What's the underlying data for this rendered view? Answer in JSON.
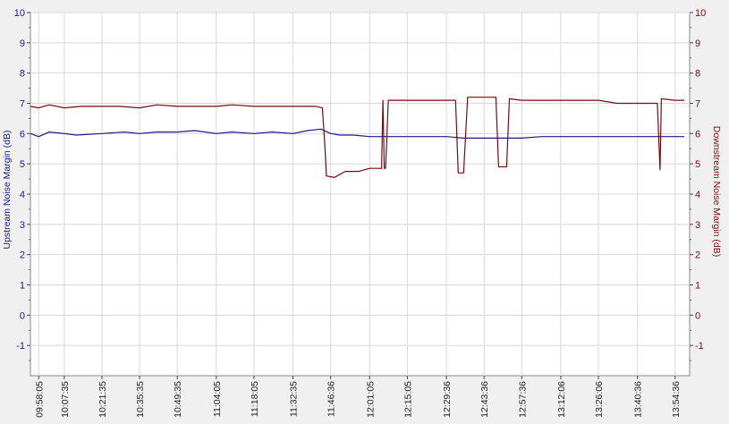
{
  "chart_data": {
    "type": "line",
    "title": "",
    "xlabel": "",
    "y_left_label": "Upstream Noise Margin (dB)",
    "y_right_label": "Downstream Noise Margin (dB)",
    "ylim": [
      -2,
      10
    ],
    "y_ticks": [
      -1,
      0,
      1,
      2,
      3,
      4,
      5,
      6,
      7,
      8,
      9,
      10
    ],
    "grid": true,
    "legend": "none",
    "colors": {
      "upstream": "#1a1a8c",
      "downstream": "#7a0a0a",
      "left_axis_text": "#1a1a8c",
      "right_axis_text": "#7a0a0a",
      "grid": "#d8d8d8"
    },
    "x_ticks": [
      "09:58:05",
      "10:07:35",
      "10:21:35",
      "10:35:35",
      "10:49:35",
      "11:04:05",
      "11:18:05",
      "11:32:35",
      "11:46:36",
      "12:01:05",
      "12:15:05",
      "12:29:36",
      "12:43:36",
      "12:57:36",
      "13:12:06",
      "13:26:06",
      "13:40:36",
      "13:54:36"
    ],
    "x_tick_times": [
      "09:58:05",
      "10:07:35",
      "10:21:35",
      "10:35:35",
      "10:49:35",
      "11:04:05",
      "11:18:05",
      "11:32:35",
      "11:46:36",
      "12:01:05",
      "12:15:05",
      "12:29:36",
      "12:43:36",
      "12:57:36",
      "13:12:06",
      "13:26:06",
      "13:40:36",
      "13:54:36"
    ],
    "series": [
      {
        "name": "Upstream Noise Margin (dB)",
        "axis": "left",
        "points": [
          [
            "09:55:00",
            6.0
          ],
          [
            "09:58:05",
            5.9
          ],
          [
            "10:02:00",
            6.05
          ],
          [
            "10:07:35",
            6.0
          ],
          [
            "10:12:00",
            5.95
          ],
          [
            "10:21:35",
            6.0
          ],
          [
            "10:30:00",
            6.05
          ],
          [
            "10:35:35",
            6.0
          ],
          [
            "10:42:00",
            6.05
          ],
          [
            "10:49:35",
            6.05
          ],
          [
            "10:56:00",
            6.1
          ],
          [
            "11:04:05",
            6.0
          ],
          [
            "11:10:00",
            6.05
          ],
          [
            "11:18:05",
            6.0
          ],
          [
            "11:25:00",
            6.05
          ],
          [
            "11:32:35",
            6.0
          ],
          [
            "11:38:00",
            6.1
          ],
          [
            "11:43:00",
            6.15
          ],
          [
            "11:46:36",
            6.0
          ],
          [
            "11:50:00",
            5.95
          ],
          [
            "11:55:00",
            5.95
          ],
          [
            "12:01:05",
            5.9
          ],
          [
            "12:08:00",
            5.9
          ],
          [
            "12:15:05",
            5.9
          ],
          [
            "12:22:00",
            5.9
          ],
          [
            "12:29:36",
            5.9
          ],
          [
            "12:36:00",
            5.85
          ],
          [
            "12:43:36",
            5.85
          ],
          [
            "12:50:00",
            5.85
          ],
          [
            "12:57:36",
            5.85
          ],
          [
            "13:05:00",
            5.9
          ],
          [
            "13:12:06",
            5.9
          ],
          [
            "13:20:00",
            5.9
          ],
          [
            "13:26:06",
            5.9
          ],
          [
            "13:33:00",
            5.9
          ],
          [
            "13:40:36",
            5.9
          ],
          [
            "13:47:00",
            5.9
          ],
          [
            "13:54:36",
            5.9
          ],
          [
            "13:58:00",
            5.9
          ]
        ]
      },
      {
        "name": "Downstream Noise Margin (dB)",
        "axis": "right",
        "points": [
          [
            "09:55:00",
            6.9
          ],
          [
            "09:58:05",
            6.85
          ],
          [
            "10:02:00",
            6.95
          ],
          [
            "10:07:35",
            6.85
          ],
          [
            "10:14:00",
            6.9
          ],
          [
            "10:21:35",
            6.9
          ],
          [
            "10:28:00",
            6.9
          ],
          [
            "10:35:35",
            6.85
          ],
          [
            "10:42:00",
            6.95
          ],
          [
            "10:49:35",
            6.9
          ],
          [
            "10:56:00",
            6.9
          ],
          [
            "11:04:05",
            6.9
          ],
          [
            "11:10:00",
            6.95
          ],
          [
            "11:18:05",
            6.9
          ],
          [
            "11:25:00",
            6.9
          ],
          [
            "11:32:35",
            6.9
          ],
          [
            "11:41:00",
            6.9
          ],
          [
            "11:43:30",
            6.85
          ],
          [
            "11:44:30",
            5.5
          ],
          [
            "11:45:00",
            4.6
          ],
          [
            "11:48:00",
            4.55
          ],
          [
            "11:52:00",
            4.75
          ],
          [
            "11:57:00",
            4.75
          ],
          [
            "12:01:05",
            4.85
          ],
          [
            "12:04:00",
            4.85
          ],
          [
            "12:05:30",
            4.85
          ],
          [
            "12:06:00",
            7.1
          ],
          [
            "12:06:30",
            4.85
          ],
          [
            "12:07:00",
            4.85
          ],
          [
            "12:08:00",
            7.1
          ],
          [
            "12:15:05",
            7.1
          ],
          [
            "12:22:00",
            7.1
          ],
          [
            "12:29:36",
            7.1
          ],
          [
            "12:33:00",
            7.1
          ],
          [
            "12:34:00",
            4.7
          ],
          [
            "12:36:00",
            4.7
          ],
          [
            "12:37:30",
            7.2
          ],
          [
            "12:43:36",
            7.2
          ],
          [
            "12:48:00",
            7.2
          ],
          [
            "12:49:00",
            4.9
          ],
          [
            "12:52:00",
            4.9
          ],
          [
            "12:53:00",
            7.15
          ],
          [
            "12:57:36",
            7.1
          ],
          [
            "13:05:00",
            7.1
          ],
          [
            "13:12:06",
            7.1
          ],
          [
            "13:20:00",
            7.1
          ],
          [
            "13:26:06",
            7.1
          ],
          [
            "13:33:00",
            7.0
          ],
          [
            "13:40:36",
            7.0
          ],
          [
            "13:48:00",
            7.0
          ],
          [
            "13:49:00",
            4.8
          ],
          [
            "13:49:30",
            7.15
          ],
          [
            "13:54:36",
            7.1
          ],
          [
            "13:58:00",
            7.1
          ]
        ]
      }
    ]
  }
}
